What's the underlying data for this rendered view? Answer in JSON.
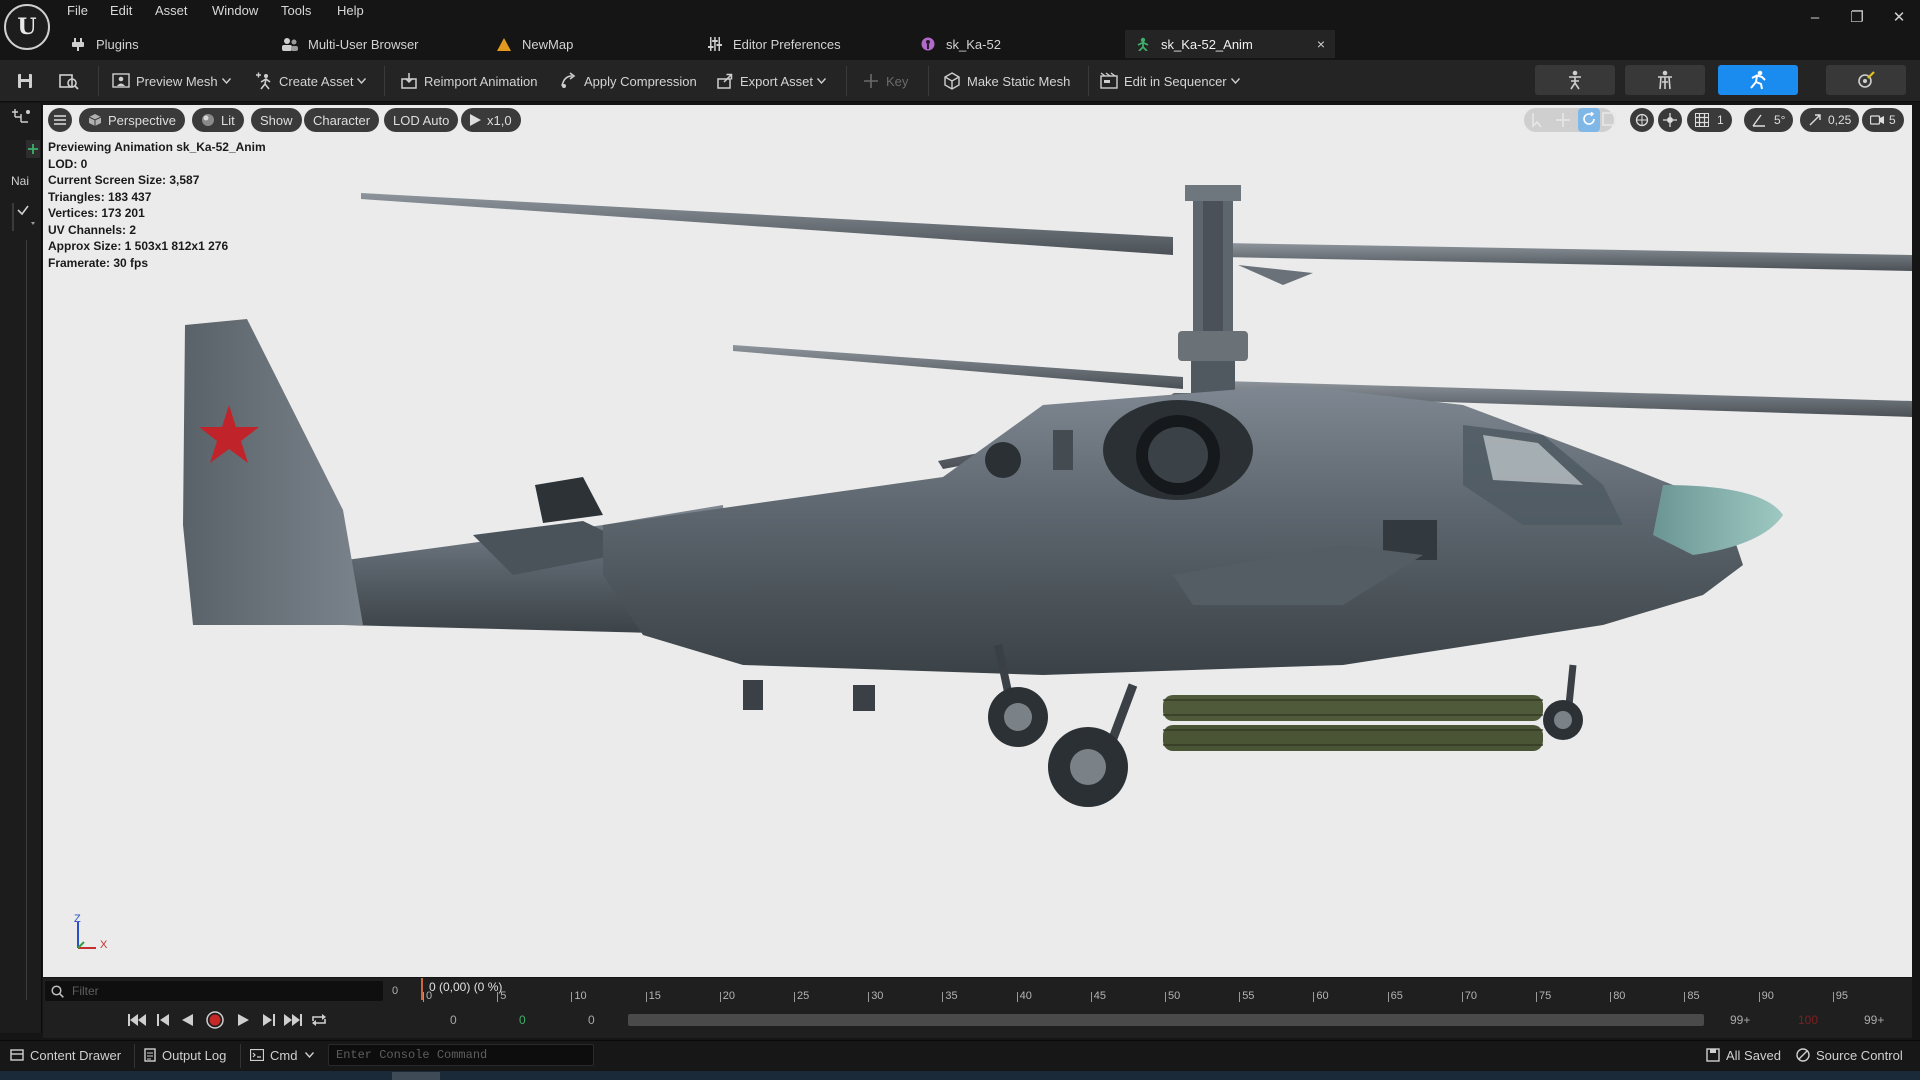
{
  "menu": [
    "File",
    "Edit",
    "Asset",
    "Window",
    "Tools",
    "Help"
  ],
  "logo": "U",
  "window_controls": {
    "minimize": "–",
    "restore": "❐",
    "close": "✕"
  },
  "tabs": [
    {
      "label": "Plugins",
      "icon": "plug-icon"
    },
    {
      "label": "Multi-User Browser",
      "icon": "users-icon"
    },
    {
      "label": "NewMap",
      "icon": "map-icon"
    },
    {
      "label": "Editor Preferences",
      "icon": "sliders-icon"
    },
    {
      "label": "sk_Ka-52",
      "icon": "skeleton-icon"
    },
    {
      "label": "sk_Ka-52_Anim",
      "icon": "animation-icon",
      "active": true
    }
  ],
  "tab_close": "×",
  "toolbar": {
    "preview_mesh": "Preview Mesh",
    "create_asset": "Create Asset",
    "reimport": "Reimport Animation",
    "compression": "Apply Compression",
    "export_asset": "Export Asset",
    "key": "Key",
    "make_static": "Make Static Mesh",
    "edit_sequencer": "Edit in Sequencer"
  },
  "left_strip": {
    "name_label": "Nai"
  },
  "viewport_bar": {
    "perspective": "Perspective",
    "lit": "Lit",
    "show": "Show",
    "character": "Character",
    "lod": "LOD Auto",
    "speed": "x1,0",
    "grid_value": "1",
    "angle_value": "5°",
    "scale_value": "0,25",
    "camera_value": "5"
  },
  "stats": [
    "Previewing Animation sk_Ka-52_Anim",
    "LOD: 0",
    "Current Screen Size: 3,587",
    "Triangles: 183 437",
    "Vertices: 173 201",
    "UV Channels: 2",
    "Approx Size: 1 503x1 812x1 276",
    "Framerate: 30 fps"
  ],
  "axis": {
    "z": "Z",
    "x": "X"
  },
  "timeline": {
    "filter_placeholder": "Filter",
    "frame_count": "0",
    "position_label": "0 (0,00) (0 %)",
    "ticks": [
      "0",
      "5",
      "10",
      "15",
      "20",
      "25",
      "30",
      "35",
      "40",
      "45",
      "50",
      "55",
      "60",
      "65",
      "70",
      "75",
      "80",
      "85",
      "90",
      "95"
    ],
    "range_start": "0",
    "range_mid": "0",
    "range_end": "0",
    "right_a": "99+",
    "right_b": "100",
    "right_c": "99+"
  },
  "statusbar": {
    "content_drawer": "Content Drawer",
    "output_log": "Output Log",
    "cmd": "Cmd",
    "console_placeholder": "Enter Console Command",
    "all_saved": "All Saved",
    "source_control": "Source Control"
  },
  "colors": {
    "accent": "#1a8cf0",
    "viewport_bg": "#ebebeb",
    "panel": "#242424"
  }
}
